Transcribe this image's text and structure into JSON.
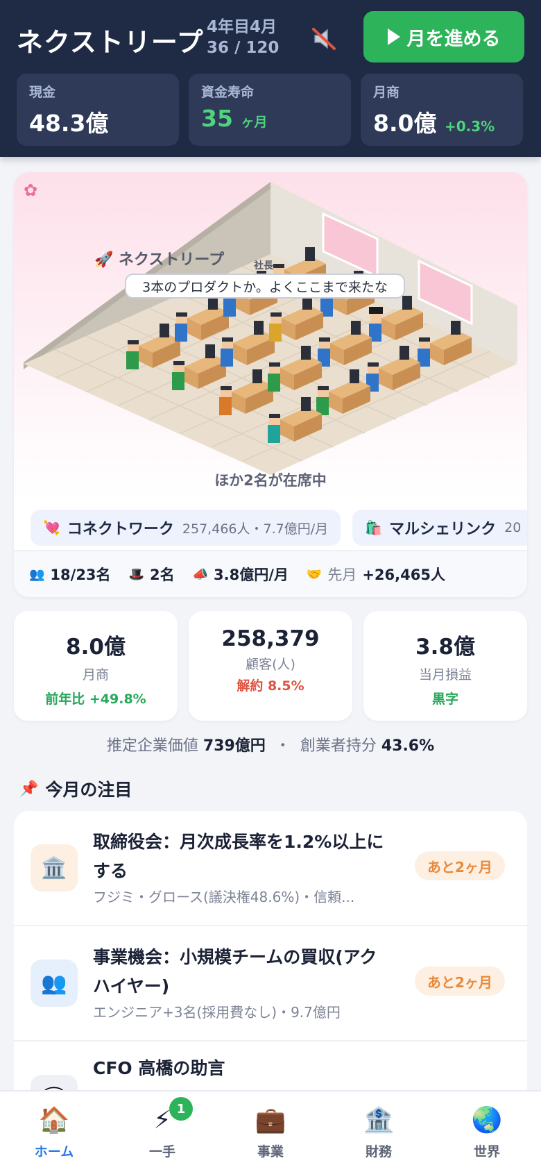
{
  "header": {
    "title": "ネクストリープ",
    "turn_label": "4年目4月",
    "turn_progress": "36 / 120",
    "advance_button": "月を進める",
    "sound_icon": "speaker-muted-icon",
    "stats": [
      {
        "label": "現金",
        "value": "48.3億",
        "unit": "",
        "delta": ""
      },
      {
        "label": "資金寿命",
        "value": "35",
        "unit": "ヶ月",
        "delta": ""
      },
      {
        "label": "月商",
        "value": "8.0億",
        "unit": "",
        "delta": "+0.3%"
      }
    ]
  },
  "office": {
    "company_label": "🚀 ネクストリープ",
    "ceo_tag": "社長",
    "speech": "3本のプロダクトか。よくここまで来たな",
    "others_present": "ほか2名が在席中",
    "products": [
      {
        "icon": "💘",
        "name": "コネクトワーク",
        "meta": "257,466人・7.7億円/月"
      },
      {
        "icon": "🛍️",
        "name": "マルシェリンク",
        "meta": "20"
      }
    ],
    "footer": {
      "staff": "18/23名",
      "executives": "2名",
      "marketing": "3.8億円/月",
      "last_month_label": "先月",
      "last_month_value": "+26,465人"
    }
  },
  "kpis": [
    {
      "value": "8.0億",
      "label": "月商",
      "sub": "前年比 +49.8%"
    },
    {
      "value": "258,379",
      "label": "顧客(人)",
      "sub": "解約 8.5%"
    },
    {
      "value": "3.8億",
      "label": "当月損益",
      "sub": "黒字"
    }
  ],
  "valuation": {
    "label": "推定企業価値",
    "value": "739億円",
    "sep": "・",
    "share_label": "創業者持分",
    "share_value": "43.6%"
  },
  "attention": {
    "title": "今月の注目",
    "items": [
      {
        "icon": "🏛️",
        "title": "取締役会：月次成長率を1.2%以上にする",
        "sub": "フジミ・グロース(議決権48.6%)・信頼...",
        "badge": "あと2ヶ月"
      },
      {
        "icon": "👥",
        "title": "事業機会：小規模チームの買収(アクハイヤー)",
        "sub": "エンジニア+3名(採用費なし)・9.7億円",
        "badge": "あと2ヶ月"
      },
      {
        "icon": "💬",
        "title": "CFO 高橋の助言",
        "sub": "",
        "badge": ""
      }
    ]
  },
  "nav": {
    "items": [
      {
        "icon": "🏠",
        "label": "ホーム"
      },
      {
        "icon": "⚡",
        "label": "一手",
        "badge": "1"
      },
      {
        "icon": "💼",
        "label": "事業"
      },
      {
        "icon": "🏦",
        "label": "財務"
      },
      {
        "icon": "🌏",
        "label": "世界"
      }
    ]
  },
  "colors": {
    "header_bg": "#1f2a44",
    "accent_green": "#2db35a",
    "accent_blue": "#2c7be5",
    "warning_orange": "#e9893a",
    "danger_red": "#e0533f"
  }
}
